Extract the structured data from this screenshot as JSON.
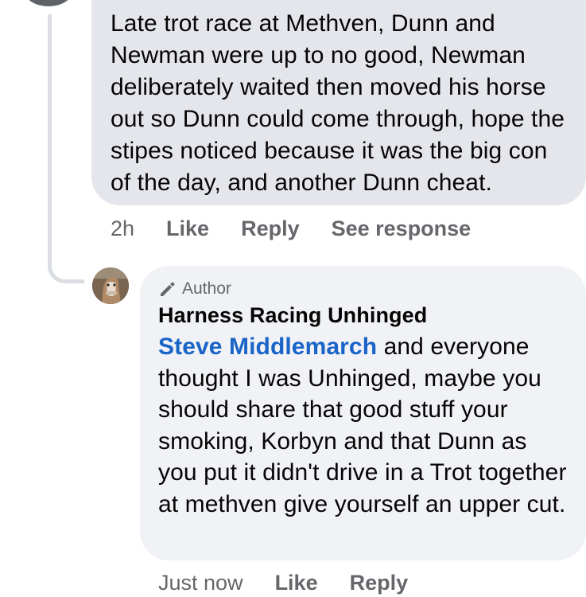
{
  "parent_comment": {
    "text": "Late trot race at Methven, Dunn and Newman were up to no good, Newman deliberately waited then moved his horse out so Dunn could come through, hope the stipes noticed because it was the big con of the day, and another Dunn cheat.",
    "time": "2h",
    "like_label": "Like",
    "reply_label": "Reply",
    "see_response_label": "See response"
  },
  "reply_comment": {
    "badge_icon": "pencil-icon",
    "badge_label": "Author",
    "author_name": "Harness Racing Unhinged",
    "mention": "Steve Middlemarch",
    "text": " and everyone thought I was Unhinged,  maybe you should share that good stuff your smoking,  Korbyn and that Dunn as you put it didn't drive in a Trot together at methven  give yourself an upper cut.",
    "time": "Just now",
    "like_label": "Like",
    "reply_label": "Reply"
  },
  "colors": {
    "parent_bubble": "#e4e6eb",
    "reply_bubble": "#f0f2f5",
    "mention_link": "#1a64c8",
    "secondary_text": "#65676b",
    "thread_line": "#dadde1"
  }
}
